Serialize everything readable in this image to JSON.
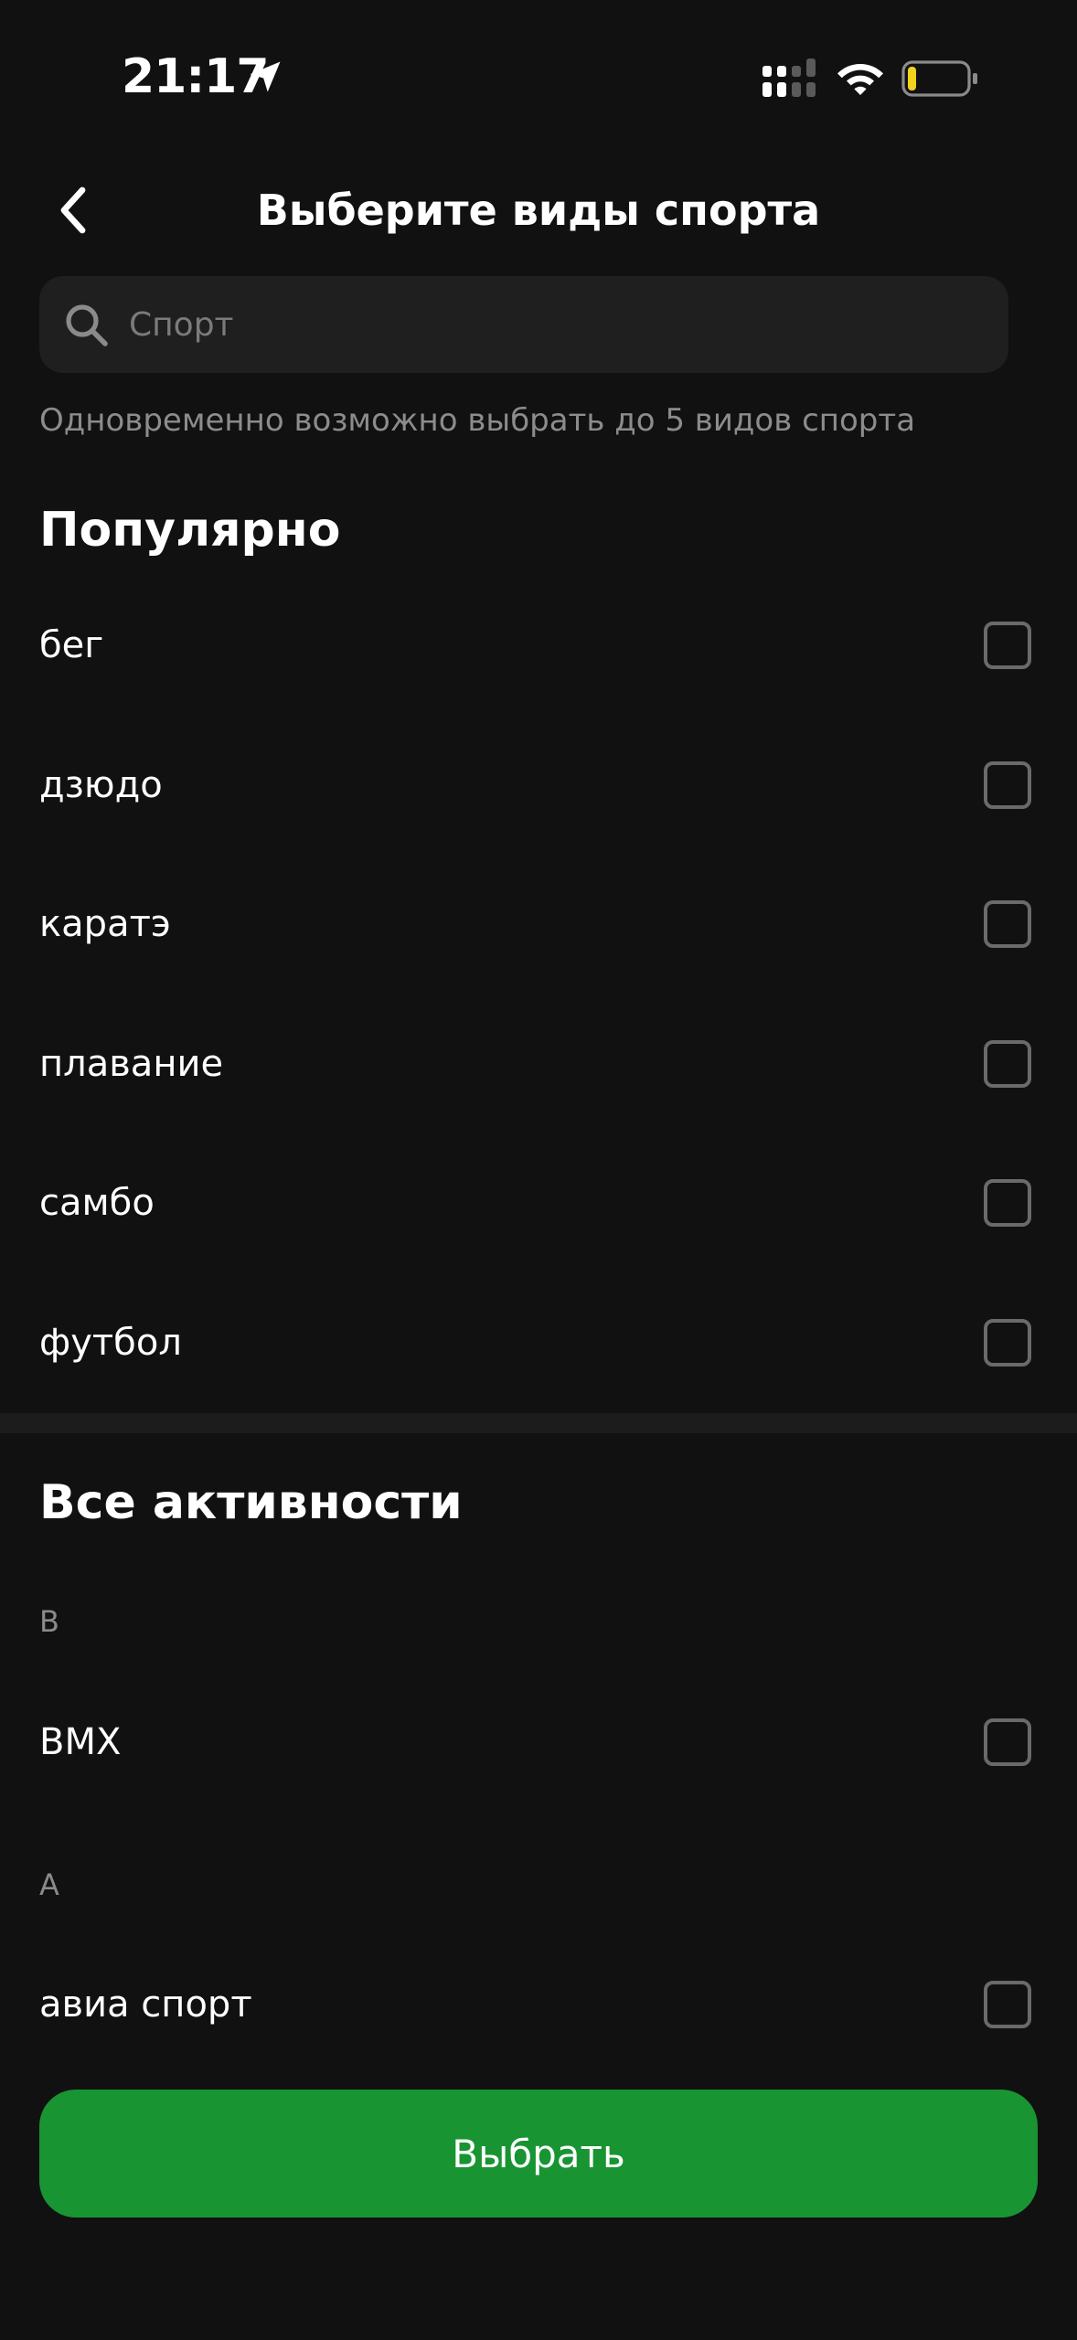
{
  "status_bar": {
    "time": "21:17",
    "icons": [
      "location-arrow-icon",
      "cellular-signal-icon",
      "wifi-icon",
      "battery-low-icon"
    ],
    "battery_color": "#f2d21b"
  },
  "header": {
    "title": "Выберите виды спорта",
    "back_icon": "chevron-left-icon"
  },
  "search": {
    "placeholder": "Спорт",
    "value": ""
  },
  "hint": "Одновременно возможно выбрать до 5 видов спорта",
  "popular": {
    "title": "Популярно",
    "items": [
      {
        "label": "бег",
        "checked": false
      },
      {
        "label": "дзюдо",
        "checked": false
      },
      {
        "label": "каратэ",
        "checked": false
      },
      {
        "label": "плавание",
        "checked": false
      },
      {
        "label": "самбо",
        "checked": false
      },
      {
        "label": "футбол",
        "checked": false
      }
    ]
  },
  "all": {
    "title": "Все активности",
    "groups": [
      {
        "letter": "B",
        "items": [
          {
            "label": "BMX",
            "checked": false
          }
        ]
      },
      {
        "letter": "А",
        "items": [
          {
            "label": "авиа спорт",
            "checked": false
          }
        ]
      }
    ]
  },
  "submit_label": "Выбрать",
  "colors": {
    "background": "#111111",
    "accent": "#199432",
    "search_bg": "#1f1f1f",
    "checkbox_border": "#6a6a6a"
  }
}
